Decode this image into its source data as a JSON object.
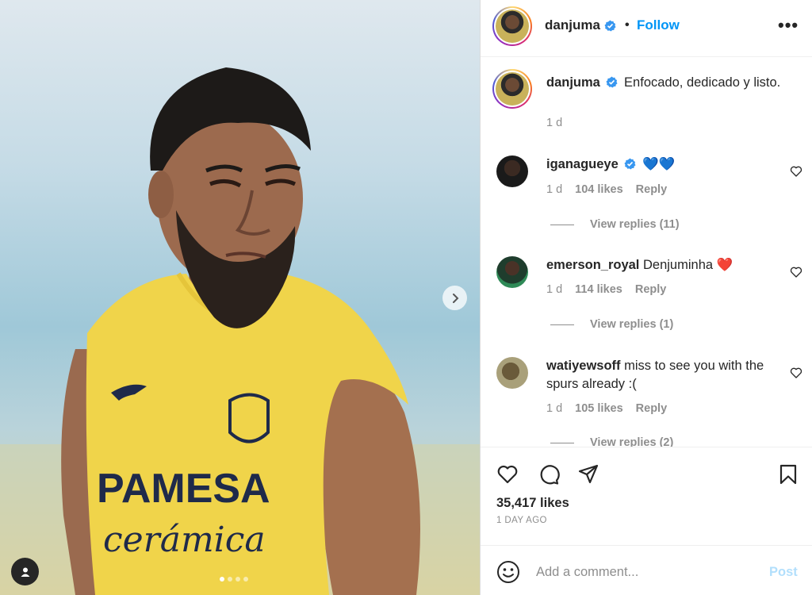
{
  "post": {
    "author": "danjuma",
    "verified": true,
    "follow_label": "Follow",
    "separator": "•",
    "more_label": "•••",
    "caption": "Enfocado, dedicado y listo.",
    "caption_time": "1 d",
    "likes": "35,417 likes",
    "posted_ago": "1 DAY AGO",
    "carousel": {
      "count": 4,
      "active_index": 0
    }
  },
  "photo": {
    "jersey_sponsor_line1": "PAMESA",
    "jersey_sponsor_line2": "cerámica"
  },
  "comments": [
    {
      "user": "iganagueye",
      "verified": true,
      "text": "💙💙",
      "time": "1 d",
      "likes": "104 likes",
      "reply_label": "Reply",
      "view_replies": "View replies (11)"
    },
    {
      "user": "emerson_royal",
      "verified": false,
      "text": "Denjuminha ❤️",
      "time": "1 d",
      "likes": "114 likes",
      "reply_label": "Reply",
      "view_replies": "View replies (1)"
    },
    {
      "user": "watiyewsoff",
      "verified": false,
      "text": "miss to see you with the spurs already :(",
      "time": "1 d",
      "likes": "105 likes",
      "reply_label": "Reply",
      "view_replies": "View replies (2)"
    }
  ],
  "add_comment": {
    "placeholder": "Add a comment...",
    "post_label": "Post"
  },
  "icons": {
    "like": "heart-icon",
    "comment": "comment-icon",
    "share": "paper-plane-icon",
    "save": "bookmark-icon",
    "emoji": "smiley-icon",
    "next": "chevron-right-icon",
    "tagged": "user-icon",
    "verified": "verified-badge-icon",
    "more": "more-options-icon"
  },
  "colors": {
    "accent": "#0095f6",
    "verified": "#3897f0",
    "post_disabled": "#b2dffc",
    "jersey": "#f0d44a",
    "secondary_text": "#8e8e8e"
  }
}
